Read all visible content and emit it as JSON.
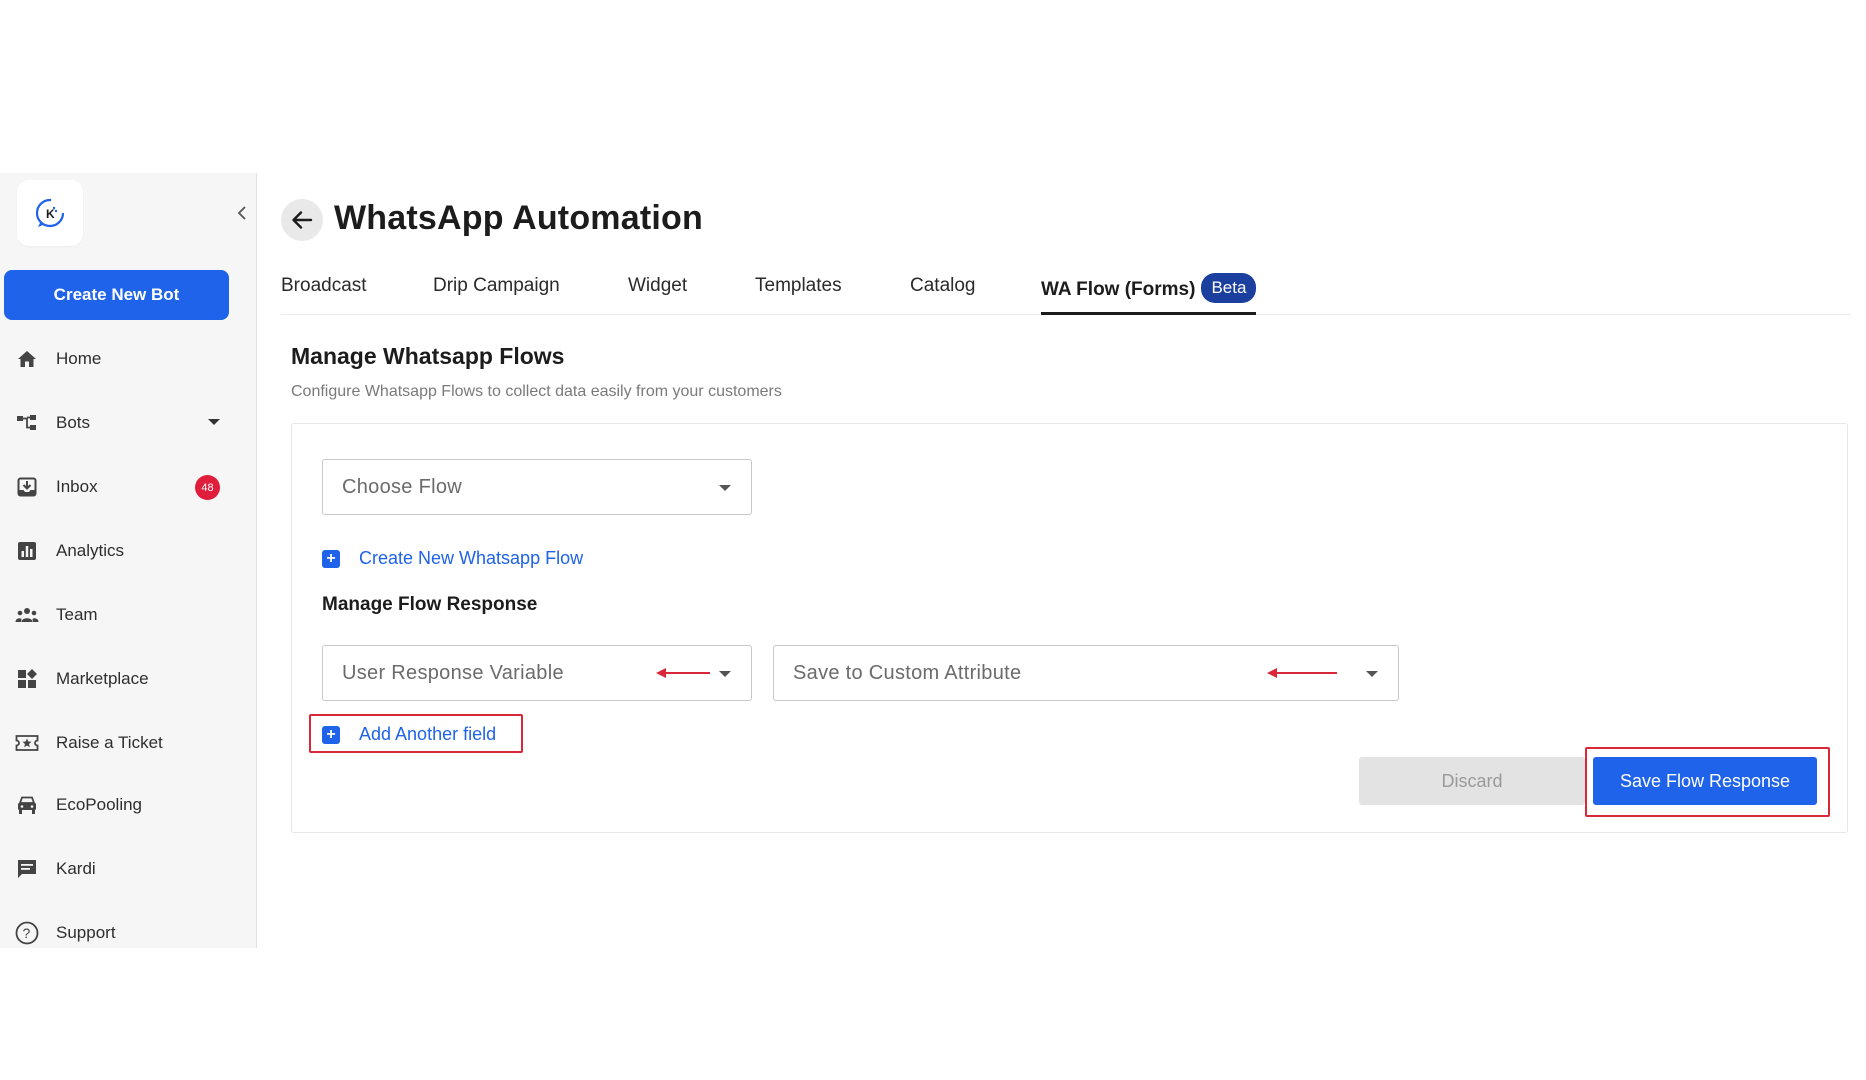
{
  "sidebar": {
    "logo_letter": "K",
    "create_bot_label": "Create New Bot",
    "items": [
      {
        "label": "Home",
        "icon": "home-icon"
      },
      {
        "label": "Bots",
        "icon": "bots-icon",
        "has_caret": true
      },
      {
        "label": "Inbox",
        "icon": "inbox-icon",
        "badge": "48"
      },
      {
        "label": "Analytics",
        "icon": "analytics-icon"
      },
      {
        "label": "Team",
        "icon": "team-icon"
      },
      {
        "label": "Marketplace",
        "icon": "marketplace-icon"
      },
      {
        "label": "Raise a Ticket",
        "icon": "ticket-icon"
      },
      {
        "label": "EcoPooling",
        "icon": "car-icon"
      },
      {
        "label": "Kardi",
        "icon": "chat-icon"
      },
      {
        "label": "Support",
        "icon": "help-icon"
      }
    ]
  },
  "header": {
    "title": "WhatsApp Automation"
  },
  "tabs": [
    {
      "label": "Broadcast"
    },
    {
      "label": "Drip Campaign"
    },
    {
      "label": "Widget"
    },
    {
      "label": "Templates"
    },
    {
      "label": "Catalog"
    },
    {
      "label": "WA Flow (Forms)",
      "badge": "Beta",
      "active": true
    }
  ],
  "section": {
    "title": "Manage Whatsapp Flows",
    "subtitle": "Configure Whatsapp Flows to collect data easily from your customers"
  },
  "form": {
    "choose_flow": "Choose Flow",
    "create_flow_link": "Create New Whatsapp Flow",
    "manage_response_title": "Manage Flow Response",
    "user_response_variable": "User Response Variable",
    "save_custom_attribute": "Save to Custom Attribute",
    "add_field_link": "Add Another field",
    "discard_label": "Discard",
    "save_label": "Save Flow Response"
  },
  "colors": {
    "primary": "#1e63e9",
    "badge_red": "#e01e3c",
    "beta_badge": "#1b3f9e",
    "annotation_red": "#d8283a"
  }
}
